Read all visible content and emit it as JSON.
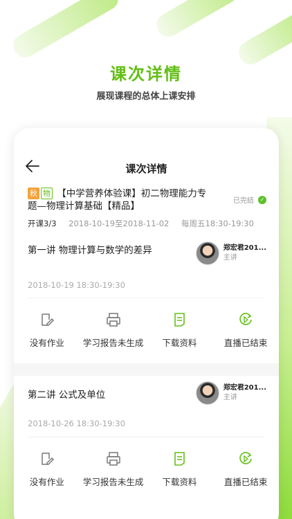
{
  "hero": {
    "title": "课次详情",
    "subtitle": "展现课程的总体上课安排"
  },
  "nav": {
    "title": "课次详情"
  },
  "course": {
    "season_badge": "秋",
    "subject_badge": "物",
    "title": "【中学营养体验课】初二物理能力专题—物理计算基础【精品】",
    "status": "已完结",
    "progress": "开课3/3",
    "date_range": "2018-10-19至2018-11-02",
    "schedule": "每周五18:30-19:30"
  },
  "lessons": [
    {
      "name": "第一讲 物理计算与数学的差异",
      "teacher": "郑宏君201...",
      "role": "主讲",
      "time": "2018-10-19 18:30-19:30",
      "actions": [
        "没有作业",
        "学习报告未生成",
        "下载资料",
        "直播已结束"
      ]
    },
    {
      "name": "第二讲 公式及单位",
      "teacher": "郑宏君201...",
      "role": "主讲",
      "time": "2018-10-26 18:30-19:30",
      "actions": [
        "没有作业",
        "学习报告未生成",
        "下载资料",
        "直播已结束"
      ]
    }
  ],
  "colors": {
    "accent": "#62bf14",
    "badge_orange": "#f3a33a"
  }
}
